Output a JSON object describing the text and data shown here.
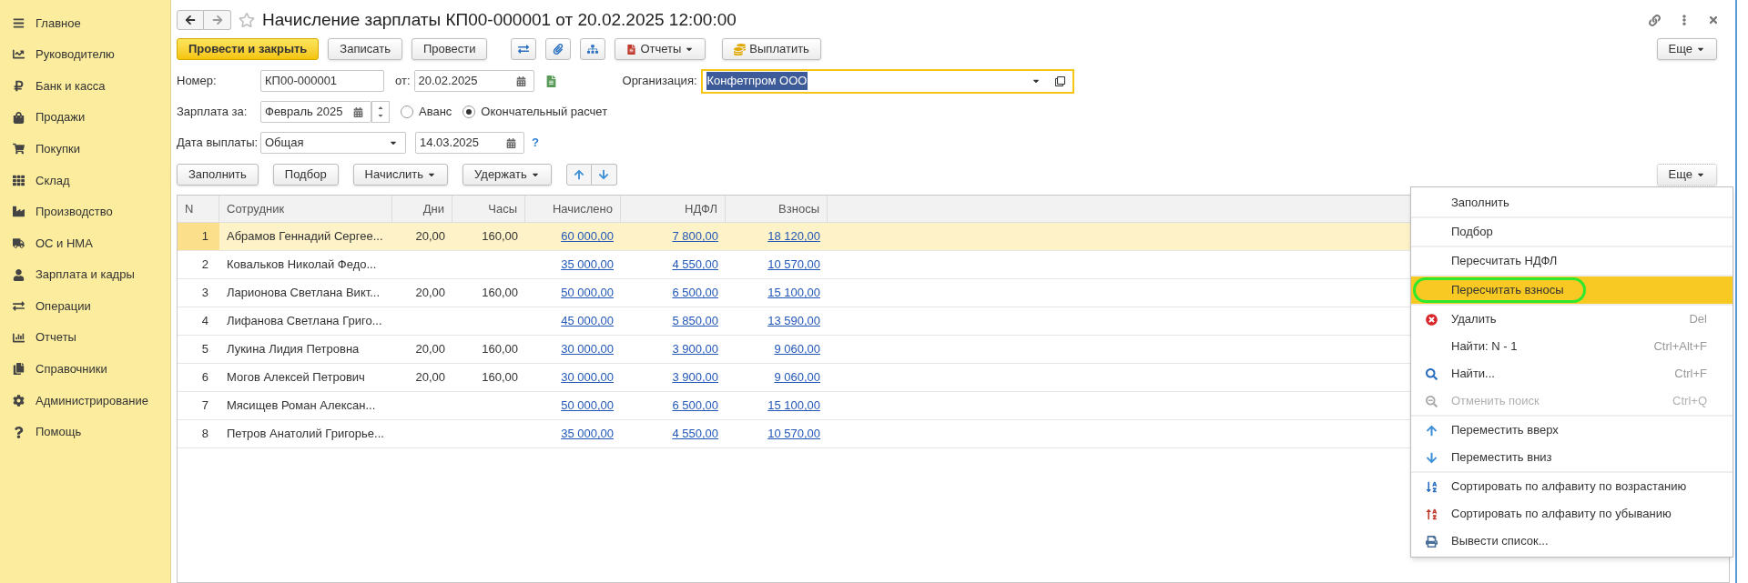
{
  "sidebar": {
    "items": [
      {
        "label": "Главное"
      },
      {
        "label": "Руководителю"
      },
      {
        "label": "Банк и касса"
      },
      {
        "label": "Продажи"
      },
      {
        "label": "Покупки"
      },
      {
        "label": "Склад"
      },
      {
        "label": "Производство"
      },
      {
        "label": "ОС и НМА"
      },
      {
        "label": "Зарплата и кадры"
      },
      {
        "label": "Операции"
      },
      {
        "label": "Отчеты"
      },
      {
        "label": "Справочники"
      },
      {
        "label": "Администрирование"
      },
      {
        "label": "Помощь"
      }
    ]
  },
  "header": {
    "title": "Начисление зарплаты КП00-000001 от 20.02.2025 12:00:00"
  },
  "toolbar": {
    "buttons": [
      {
        "label": "Провести и закрыть",
        "kind": "primary"
      },
      {
        "label": "Записать",
        "kind": "plain"
      },
      {
        "label": "Провести",
        "kind": "plain"
      },
      {
        "kind": "icon"
      },
      {
        "kind": "icon"
      },
      {
        "kind": "icon"
      },
      {
        "label": "Отчеты",
        "kind": "dropdown"
      },
      {
        "label": "Выплатить",
        "kind": "coin"
      }
    ],
    "more_button": "Еще"
  },
  "form": {
    "number_label": "Номер:",
    "number": "КП00-000001",
    "date_label": "от:",
    "date": "20.02.2025",
    "organization_label": "Организация:",
    "organization": "Конфетпром ООО",
    "period_label": "Зарплата за:",
    "period": "Февраль 2025",
    "payment_types": [
      {
        "label": "Аванс",
        "selected": false
      },
      {
        "label": "Окончательный расчет",
        "selected": true
      }
    ],
    "payment_date_label": "Дата выплаты:",
    "payment_schedule": "Общая",
    "payment_date": "14.03.2025",
    "help": "?"
  },
  "table_toolbar": {
    "buttons": [
      {
        "label": "Заполнить",
        "kind": "plain"
      },
      {
        "label": "Подбор",
        "kind": "plain"
      },
      {
        "label": "Начислить",
        "kind": "dropdown"
      },
      {
        "label": "Удержать",
        "kind": "dropdown"
      }
    ],
    "more_button": "Еще"
  },
  "table": {
    "columns": [
      "N",
      "Сотрудник",
      "Дни",
      "Часы",
      "Начислено",
      "НДФЛ",
      "Взносы"
    ],
    "rows": [
      {
        "selected": true,
        "n": "1",
        "employee": "Абрамов Геннадий Сергее...",
        "days": "20,00",
        "hours": "160,00",
        "accrued": "60 000,00",
        "ndfl": "7 800,00",
        "contributions": "18 120,00"
      },
      {
        "selected": false,
        "n": "2",
        "employee": "Ковальков Николай Федо...",
        "accrued": "35 000,00",
        "ndfl": "4 550,00",
        "contributions": "10 570,00"
      },
      {
        "selected": false,
        "n": "3",
        "employee": "Ларионова Светлана Викт...",
        "days": "20,00",
        "hours": "160,00",
        "accrued": "50 000,00",
        "ndfl": "6 500,00",
        "contributions": "15 100,00"
      },
      {
        "selected": false,
        "n": "4",
        "employee": "Лифанова Светлана Григо...",
        "accrued": "45 000,00",
        "ndfl": "5 850,00",
        "contributions": "13 590,00"
      },
      {
        "selected": false,
        "n": "5",
        "employee": "Лукина Лидия Петровна",
        "days": "20,00",
        "hours": "160,00",
        "accrued": "30 000,00",
        "ndfl": "3 900,00",
        "contributions": "9 060,00"
      },
      {
        "selected": false,
        "n": "6",
        "employee": "Могов Алексей Петрович",
        "days": "20,00",
        "hours": "160,00",
        "accrued": "30 000,00",
        "ndfl": "3 900,00",
        "contributions": "9 060,00"
      },
      {
        "selected": false,
        "n": "7",
        "employee": "Мясищев Роман Алексан...",
        "accrued": "50 000,00",
        "ndfl": "6 500,00",
        "contributions": "15 100,00"
      },
      {
        "selected": false,
        "n": "8",
        "employee": "Петров Анатолий Григорье...",
        "accrued": "35 000,00",
        "ndfl": "4 550,00",
        "contributions": "10 570,00"
      }
    ]
  },
  "context_menu": {
    "groups": [
      [
        {
          "label": "Заполнить",
          "selected": false,
          "disabled": false
        }
      ],
      [
        {
          "label": "Подбор",
          "selected": false,
          "disabled": false
        }
      ],
      [
        {
          "label": "Пересчитать НДФЛ",
          "selected": false,
          "disabled": false
        }
      ],
      [
        {
          "label": "Пересчитать взносы",
          "selected": true,
          "disabled": false
        }
      ],
      [
        {
          "label": "Удалить",
          "shortcut": "Del",
          "selected": false,
          "disabled": false
        },
        {
          "label": "Найти: N - 1",
          "shortcut": "Ctrl+Alt+F",
          "selected": false,
          "disabled": false
        },
        {
          "label": "Найти...",
          "shortcut": "Ctrl+F",
          "selected": false,
          "disabled": false
        },
        {
          "label": "Отменить поиск",
          "shortcut": "Ctrl+Q",
          "selected": false,
          "disabled": true
        }
      ],
      [
        {
          "label": "Переместить вверх",
          "selected": false,
          "disabled": false
        },
        {
          "label": "Переместить вниз",
          "selected": false,
          "disabled": false
        }
      ],
      [
        {
          "label": "Сортировать по алфавиту по возрастанию",
          "selected": false,
          "disabled": false
        },
        {
          "label": "Сортировать по алфавиту по убыванию",
          "selected": false,
          "disabled": false
        },
        {
          "label": "Вывести список...",
          "selected": false,
          "disabled": false
        }
      ]
    ]
  }
}
